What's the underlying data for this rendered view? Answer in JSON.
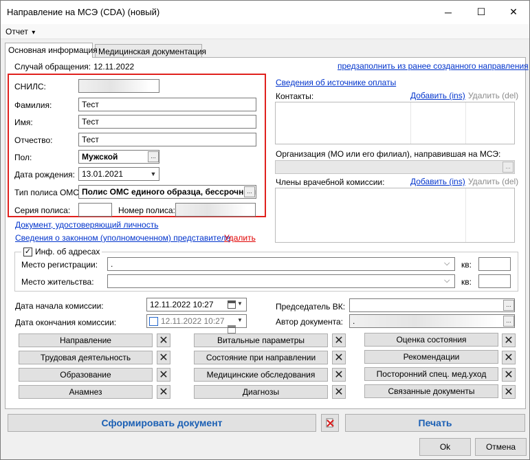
{
  "window": {
    "title": "Направление на МСЭ (CDA) (новый)",
    "minimize_glyph": "─",
    "maximize_glyph": "☐",
    "close_glyph": "✕"
  },
  "menu": {
    "report": "Отчет",
    "report_arrow": "▾"
  },
  "tabs": [
    {
      "label": "Основная информация",
      "active": true
    },
    {
      "label": "Медицинская документация",
      "active": false
    }
  ],
  "case": {
    "label": "Случай обращения:",
    "value": "12.11.2022",
    "prefill_link": "предзаполнить из ранее созданного направления"
  },
  "patient": {
    "snils_label": "СНИЛС:",
    "snils_value": "",
    "lastname_label": "Фамилия:",
    "lastname_value": "Тест",
    "firstname_label": "Имя:",
    "firstname_value": "Тест",
    "middlename_label": "Отчество:",
    "middlename_value": "Тест",
    "sex_label": "Пол:",
    "sex_value": "Мужской",
    "birthdate_label": "Дата рождения:",
    "birthdate_value": "13.01.2021",
    "policy_type_label": "Тип полиса ОМС:",
    "policy_type_value": "Полис ОМС единого образца, бессрочный",
    "policy_series_label": "Серия полиса:",
    "policy_series_value": "",
    "policy_number_label": "Номер полиса:",
    "policy_number_value": ""
  },
  "links": {
    "identity_doc": "Документ, удостоверяющий личность",
    "legal_rep": "Сведения о законном (уполномоченном) представителе",
    "delete": "Удалить",
    "payment_source": "Сведения об источнике оплаты"
  },
  "contacts": {
    "label": "Контакты:",
    "add": "Добавить (ins)",
    "remove": "Удалить (del)"
  },
  "organization": {
    "label": "Организация (МО или его филиал), направившая на МСЭ:",
    "value": ""
  },
  "commission": {
    "label": "Члены врачебной комиссии:",
    "add": "Добавить (ins)",
    "remove": "Удалить (del)"
  },
  "addresses": {
    "checkbox_label": "Инф. об адресах",
    "checked": true,
    "registration_label": "Место регистрации:",
    "registration_value": ".",
    "residence_label": "Место жительства:",
    "residence_value": "",
    "apt_label": "кв:"
  },
  "dates": {
    "start_label": "Дата начала комиссии:",
    "start_value": "12.11.2022 10:27",
    "end_label": "Дата окончания комиссии:",
    "end_value": "12.11.2022 10:27"
  },
  "chair": {
    "label": "Председатель ВК:",
    "value": ""
  },
  "author": {
    "label": "Автор документа:",
    "value": "."
  },
  "sections": {
    "col1": [
      "Направление",
      "Трудовая деятельность",
      "Образование",
      "Анамнез"
    ],
    "col2": [
      "Витальные параметры",
      "Состояние при направлении",
      "Медицинские обследования",
      "Диагнозы"
    ],
    "col3": [
      "Оценка состояния",
      "Рекомендации",
      "Посторонний спец. мед.уход",
      "Связанные документы"
    ],
    "remove_glyph": "✕"
  },
  "actions": {
    "generate": "Сформировать документ",
    "print": "Печать"
  },
  "dialog": {
    "ok": "Ok",
    "cancel": "Отмена"
  },
  "glyphs": {
    "dots": "...",
    "dropdown": "▼",
    "chevron": "⌵",
    "check": "✓"
  }
}
